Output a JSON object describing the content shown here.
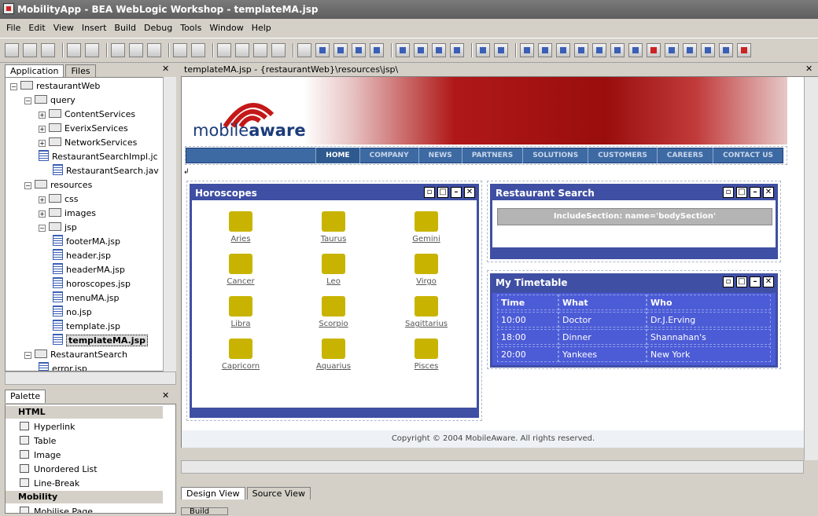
{
  "window": {
    "title": "MobilityApp - BEA WebLogic Workshop - templateMA.jsp"
  },
  "menu": [
    "File",
    "Edit",
    "View",
    "Insert",
    "Build",
    "Debug",
    "Tools",
    "Window",
    "Help"
  ],
  "toolbar": {
    "icons": [
      "new-icon",
      "open-icon",
      "save-icon",
      "save-all-icon",
      "undo-icon",
      "redo-icon",
      "cut-icon",
      "copy-icon",
      "paste-icon",
      "back-icon",
      "forward-icon",
      "indent-icon",
      "outdent-icon",
      "find-icon",
      "replace-icon",
      "start-icon",
      "pause-icon",
      "stop-icon",
      "step-icon",
      "step-into-icon",
      "step-over-icon",
      "step-out-icon",
      "breakpoint-icon",
      "clear-icon",
      "build-icon",
      "deploy-icon",
      "calendar-icon",
      "toolbox-icon",
      "move-icon",
      "zoom-icon",
      "search-icon",
      "inspect-icon",
      "delete-icon",
      "go-icon",
      "run-icon",
      "test-icon",
      "export-icon",
      "warning-icon"
    ]
  },
  "app_panel": {
    "tabs": [
      "Application",
      "Files"
    ],
    "tree": [
      {
        "label": "restaurantWeb",
        "depth": 0,
        "type": "project"
      },
      {
        "label": "query",
        "depth": 1,
        "type": "folder"
      },
      {
        "label": "ContentServices",
        "depth": 2,
        "type": "folder"
      },
      {
        "label": "EverixServices",
        "depth": 2,
        "type": "folder"
      },
      {
        "label": "NetworkServices",
        "depth": 2,
        "type": "folder"
      },
      {
        "label": "RestaurantSearchImpl.jc",
        "depth": 2,
        "type": "file"
      },
      {
        "label": "RestaurantSearch.jav",
        "depth": 3,
        "type": "file"
      },
      {
        "label": "resources",
        "depth": 1,
        "type": "folder"
      },
      {
        "label": "css",
        "depth": 2,
        "type": "folder"
      },
      {
        "label": "images",
        "depth": 2,
        "type": "folder"
      },
      {
        "label": "jsp",
        "depth": 2,
        "type": "folder"
      },
      {
        "label": "footerMA.jsp",
        "depth": 3,
        "type": "file"
      },
      {
        "label": "header.jsp",
        "depth": 3,
        "type": "file"
      },
      {
        "label": "headerMA.jsp",
        "depth": 3,
        "type": "file"
      },
      {
        "label": "horoscopes.jsp",
        "depth": 3,
        "type": "file"
      },
      {
        "label": "menuMA.jsp",
        "depth": 3,
        "type": "file"
      },
      {
        "label": "no.jsp",
        "depth": 3,
        "type": "file"
      },
      {
        "label": "template.jsp",
        "depth": 3,
        "type": "file"
      },
      {
        "label": "templateMA.jsp",
        "depth": 3,
        "type": "file",
        "selected": true
      },
      {
        "label": "RestaurantSearch",
        "depth": 1,
        "type": "folder"
      },
      {
        "label": "error.jsp",
        "depth": 2,
        "type": "file"
      }
    ]
  },
  "palette": {
    "title": "Palette",
    "sections": [
      {
        "name": "HTML",
        "items": [
          "Hyperlink",
          "Table",
          "Image",
          "Unordered List",
          "Line-Break"
        ]
      },
      {
        "name": "Mobility",
        "items": [
          "Mobilise Page"
        ]
      }
    ]
  },
  "editor": {
    "tab_title": "templateMA.jsp - {restaurantWeb}\\resources\\jsp\\",
    "view_tabs": [
      "Design View",
      "Source View"
    ],
    "build_tab": "Build",
    "page": {
      "logo": {
        "light": "mobile",
        "bold": "aware"
      },
      "nav": [
        "HOME",
        "COMPANY",
        "NEWS",
        "PARTNERS",
        "SOLUTIONS",
        "CUSTOMERS",
        "CAREERS",
        "CONTACT US"
      ],
      "horoscopes": {
        "title": "Horoscopes",
        "signs": [
          "Aries",
          "Taurus",
          "Gemini",
          "Cancer",
          "Leo",
          "Virgo",
          "Libra",
          "Scorpio",
          "Sagittarius",
          "Capricorn",
          "Aquarius",
          "Pisces"
        ]
      },
      "restaurant": {
        "title": "Restaurant Search",
        "include": "IncludeSection: name='bodySection'"
      },
      "timetable": {
        "title": "My Timetable",
        "headers": [
          "Time",
          "What",
          "Who"
        ],
        "rows": [
          [
            "10:00",
            "Doctor",
            "Dr.J.Erving"
          ],
          [
            "18:00",
            "Dinner",
            "Shannahan's"
          ],
          [
            "20:00",
            "Yankees",
            "New York"
          ]
        ]
      },
      "footer": "Copyright © 2004 MobileAware. All rights reserved."
    }
  }
}
